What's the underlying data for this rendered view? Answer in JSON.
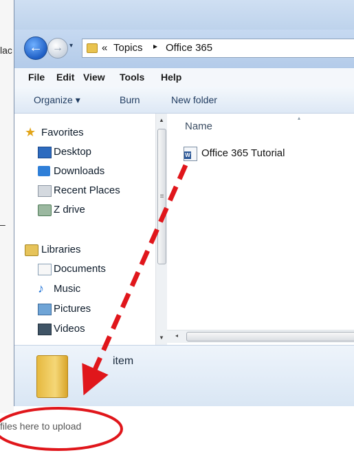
{
  "backdrop": {
    "partial_text": "lac",
    "dash": "–"
  },
  "nav": {
    "back_glyph": "←",
    "forward_glyph": "→",
    "history_glyph": "▾"
  },
  "address": {
    "chevrons": "«",
    "crumb_1": "Topics",
    "separator": "▸",
    "current": "Office 365"
  },
  "menu": {
    "file": "File",
    "edit": "Edit",
    "view": "View",
    "tools": "Tools",
    "help": "Help"
  },
  "commands": {
    "organize": "Organize ▾",
    "burn": "Burn",
    "new_folder": "New folder"
  },
  "navigation_pane": {
    "favorites_header": "Favorites",
    "favorites": [
      "Desktop",
      "Downloads",
      "Recent Places",
      "Z drive"
    ],
    "libraries_header": "Libraries",
    "libraries": [
      "Documents",
      "Music",
      "Pictures",
      "Videos"
    ],
    "scroll_up_glyph": "▲",
    "scroll_down_glyph": "▼",
    "scroll_grip_glyph": "≡"
  },
  "file_list": {
    "column_name": "Name",
    "sort_glyph": "▴",
    "files": [
      {
        "name": "Office 365 Tutorial",
        "icon": "word-document-icon",
        "icon_letter": "W"
      }
    ],
    "h_scroll_left_glyph": "◂"
  },
  "details": {
    "text": "item"
  },
  "upload_area": {
    "label": "files here to upload"
  },
  "colors": {
    "annotation_red": "#e0161b",
    "window_blue": "#c6d9f1",
    "folder_gold": "#e6b93f"
  }
}
